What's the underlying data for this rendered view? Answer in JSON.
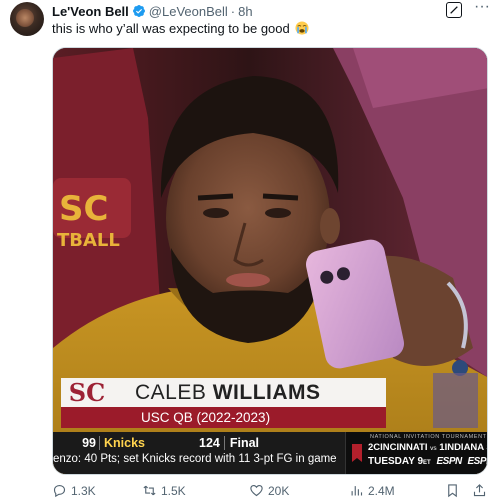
{
  "author": {
    "display_name": "Le'Veon Bell",
    "handle": "@LeVeonBell",
    "separator": "·",
    "time": "8h",
    "verified": true
  },
  "tweet": {
    "text": "this is who y’all was expecting to be good",
    "emoji": "loudly-crying-face-emoji"
  },
  "header_icons": {
    "grok": "grok-icon",
    "more": "more-icon",
    "more_glyph": "···"
  },
  "media": {
    "jersey_letters_1": "SC",
    "jersey_letters_2": "TBALL",
    "lower_third": {
      "logo": "SC",
      "first_name": "CALEB",
      "last_name": "WILLIAMS",
      "subtitle": "USC QB (2022-2023)"
    },
    "ticker": {
      "away_score": "99",
      "team": "Knicks",
      "home_score": "124",
      "status": "Final",
      "news": "enzo: 40 Pts; set Knicks record with 11 3-pt FG in game",
      "promo_title": "NATIONAL INVITATION TOURNAMENT",
      "promo_seed_1": "2",
      "promo_team_1": "CINCINNATI",
      "promo_vs": "vs",
      "promo_seed_2": "1",
      "promo_team_2": "INDIANA ST",
      "promo_date": "TUESDAY 9",
      "promo_date_suffix": "ET",
      "promo_network_1": "ESPN",
      "promo_network_2": "ESPN+"
    },
    "colors": {
      "usc_cardinal": "#9b1b2a",
      "usc_gold": "#e8b33a",
      "ticker_bg": "#1a1a1a",
      "knicks_accent": "#ffd34e"
    }
  },
  "actions": {
    "replies": "1.3K",
    "retweets": "1.5K",
    "likes": "20K",
    "views": "2.4M"
  },
  "theme": {
    "accent": "#1d9bf0",
    "text_secondary": "#536471"
  }
}
